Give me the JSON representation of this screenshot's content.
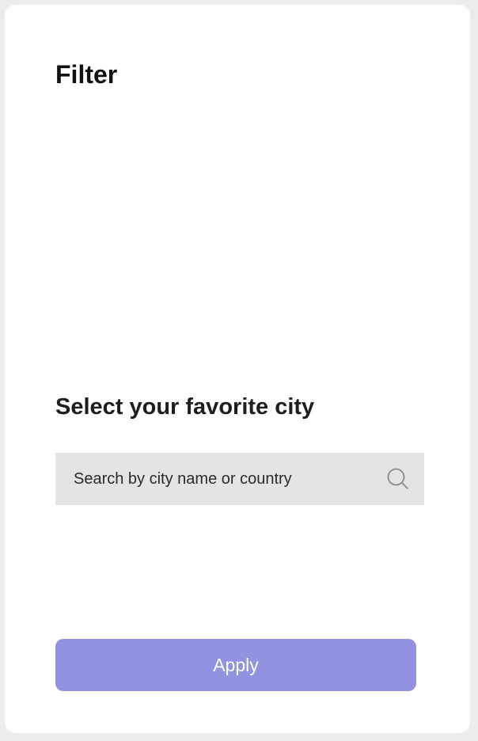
{
  "header": {
    "title": "Filter"
  },
  "city_section": {
    "heading": "Select your favorite city",
    "search": {
      "placeholder": "Search by city name or country",
      "value": "",
      "icon": "search-icon"
    }
  },
  "actions": {
    "apply_label": "Apply"
  },
  "colors": {
    "page_background": "#ececec",
    "panel_background": "#ffffff",
    "search_background": "#e4e4e4",
    "apply_button": "#9192e0"
  }
}
